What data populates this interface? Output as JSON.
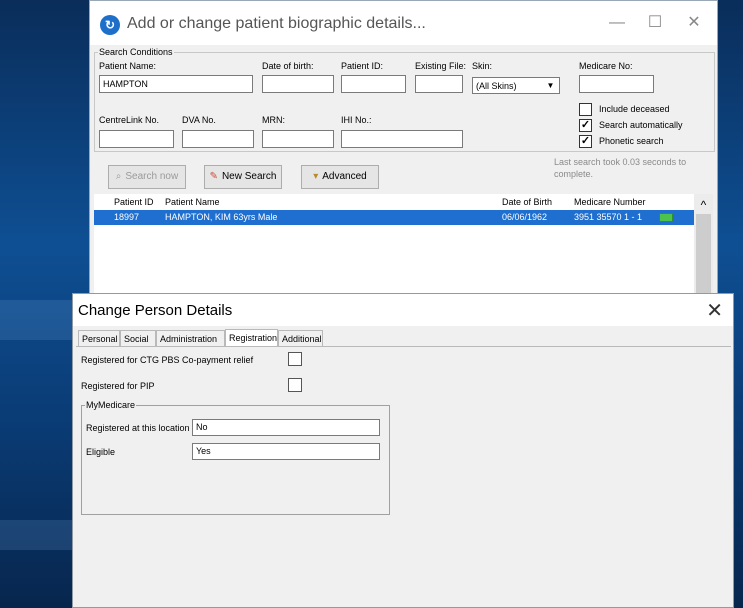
{
  "search_window": {
    "title": "Add or change patient biographic details...",
    "controls": {
      "minimize": "—",
      "maximize": "☐",
      "close": "✕"
    },
    "search_conditions": {
      "legend": "Search Conditions",
      "patient_name_label": "Patient Name:",
      "patient_name_value": "HAMPTON",
      "dob_label": "Date of birth:",
      "patient_id_label": "Patient ID:",
      "existing_file_label": "Existing File:",
      "skin_label": "Skin:",
      "skin_value": "(All Skins)",
      "medicare_label": "Medicare No:",
      "centrelink_label": "CentreLink No.",
      "dva_label": "DVA No.",
      "mrn_label": "MRN:",
      "ihi_label": "IHI No.:",
      "include_deceased": {
        "label": "Include deceased",
        "checked": false
      },
      "search_automatically": {
        "label": "Search automatically",
        "checked": true
      },
      "phonetic_search": {
        "label": "Phonetic search",
        "checked": true
      }
    },
    "buttons": {
      "search_now": "Search now",
      "new_search": "New Search",
      "advanced": "Advanced"
    },
    "status_note": "Last search took 0.03 seconds to complete.",
    "results": {
      "columns": [
        "Patient ID",
        "Patient Name",
        "Date of Birth",
        "Medicare Number"
      ],
      "rows": [
        {
          "patient_id": "18997",
          "patient_name": "HAMPTON, KIM 63yrs Male",
          "dob": "06/06/1962",
          "medicare": "3951 35570 1 - 1"
        }
      ]
    }
  },
  "person_dialog": {
    "title": "Change Person Details",
    "close": "✕",
    "tabs": [
      "Personal",
      "Social",
      "Administration",
      "Registration",
      "Additional"
    ],
    "active_tab": "Registration",
    "ctg_label": "Registered for CTG PBS Co-payment relief",
    "ctg_checked": false,
    "pip_label": "Registered for PIP",
    "pip_checked": false,
    "mymedicare": {
      "legend": "MyMedicare",
      "registered_label": "Registered at this location",
      "registered_value": "No",
      "eligible_label": "Eligible",
      "eligible_value": "Yes"
    }
  },
  "colors": {
    "selection": "#1e6fd0",
    "app_icon": "#1e6fc9",
    "card_icon": "#4dc24d"
  }
}
